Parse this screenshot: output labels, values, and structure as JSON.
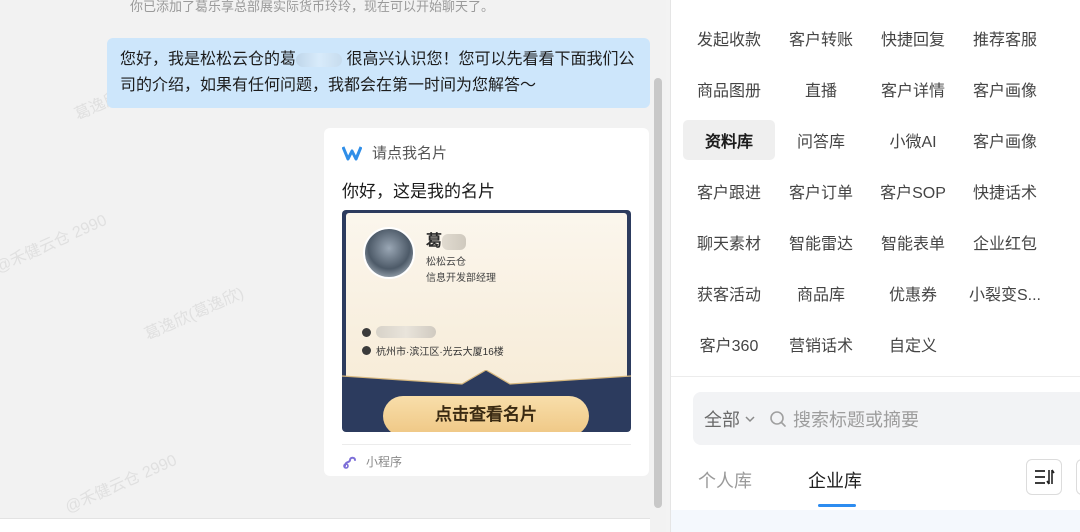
{
  "chat": {
    "system_message": "你已添加了葛乐享总部展实际货币玲玲，现在可以开始聊天了。",
    "greeting_part1": "您好，我是松松云仓的葛",
    "greeting_part2": "很高兴认识您！您可以先看看下面我们公司的介绍，如果有任何问题，我都会在第一时间为您解答～",
    "card": {
      "header_label": "请点我名片",
      "title": "你好，这是我的名片",
      "name_initial": "葛",
      "company": "松松云仓",
      "job_title": "信息开发部经理",
      "address": "杭州市·滨江区·光云大厦16楼",
      "view_button": "点击查看名片",
      "footer_label": "小程序"
    },
    "watermarks": [
      "葛逸欣(葛逸欣)",
      "@禾健云仓 2990",
      "葛逸欣(葛逸欣)",
      "@禾健云仓 2990",
      "葛逸欣(葛逸欣)@禾健云仓 2990"
    ]
  },
  "tools": {
    "items": [
      "发起收款",
      "客户转账",
      "快捷回复",
      "推荐客服",
      "商品图册",
      "直播",
      "客户详情",
      "客户画像",
      "资料库",
      "问答库",
      "小微AI",
      "客户画像",
      "客户跟进",
      "客户订单",
      "客户SOP",
      "快捷话术",
      "聊天素材",
      "智能雷达",
      "智能表单",
      "企业红包",
      "获客活动",
      "商品库",
      "优惠券",
      "小裂变S...",
      "客户360",
      "营销话术",
      "自定义"
    ],
    "active_item": "资料库",
    "search": {
      "filter_label": "全部",
      "placeholder": "搜索标题或摘要"
    },
    "tabs": {
      "personal": "个人库",
      "enterprise": "企业库"
    }
  },
  "colors": {
    "bubble": "#cde6fb",
    "accent": "#2d8cf0",
    "card_navy": "#2c3b5e",
    "button_gold": "#efc784"
  }
}
